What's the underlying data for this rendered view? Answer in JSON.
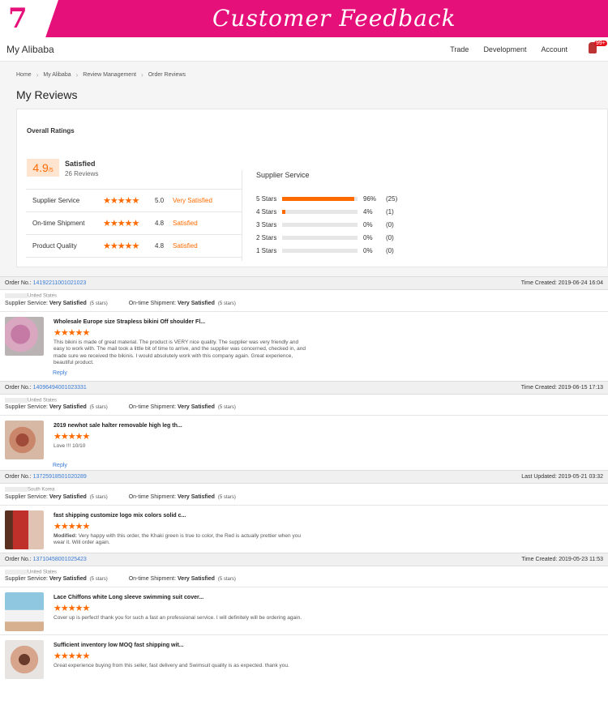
{
  "banner": {
    "number": "7",
    "title": "Customer Feedback"
  },
  "topbar": {
    "brand": "My Alibaba",
    "nav": [
      "Trade",
      "Development",
      "Account"
    ],
    "badge": "99+"
  },
  "breadcrumb": [
    "Home",
    "My Alibaba",
    "Review Management",
    "Order Reviews"
  ],
  "page_title": "My Reviews",
  "overall": {
    "heading": "Overall Ratings",
    "score": "4.9",
    "score_max": "/5",
    "label": "Satisfied",
    "reviews": "26 Reviews",
    "rows": [
      {
        "label": "Supplier Service",
        "value": "5.0",
        "desc": "Very Satisfied"
      },
      {
        "label": "On-time Shipment",
        "value": "4.8",
        "desc": "Satisfied"
      },
      {
        "label": "Product Quality",
        "value": "4.8",
        "desc": "Satisfied"
      }
    ],
    "supplier_service": {
      "title": "Supplier Service",
      "bars": [
        {
          "stars": "5 Stars",
          "pct": "96%",
          "count": "(25)",
          "fraction": 0.96
        },
        {
          "stars": "4 Stars",
          "pct": "4%",
          "count": "(1)",
          "fraction": 0.04
        },
        {
          "stars": "3 Stars",
          "pct": "0%",
          "count": "(0)",
          "fraction": 0
        },
        {
          "stars": "2 Stars",
          "pct": "0%",
          "count": "(0)",
          "fraction": 0
        },
        {
          "stars": "1 Stars",
          "pct": "0%",
          "count": "(0)",
          "fraction": 0
        }
      ]
    }
  },
  "stars_glyph": "★★★★★",
  "orders": [
    {
      "order_label": "Order No.:",
      "order_no": "14192211001021023",
      "time": "Time Created: 2019-06-24 16:04",
      "country": "United States",
      "supplier_service": "Very Satisfied",
      "supplier_stars": "(5 stars)",
      "shipment": "Very Satisfied",
      "shipment_stars": "(5 stars)",
      "items": [
        {
          "title": "Wholesale Europe size Strapless bikini Off shoulder Fl...",
          "comment": "This bikini is made of great material. The product is VERY nice quality. The supplier was very friendly and easy to work with. The mail took a little bit of time to arrive, and the supplier was concerned, checked in, and made sure we received the bikinis. I would absolutely work with this company again. Great experience, beautiful product.",
          "modified": ""
        }
      ],
      "reply": "Reply"
    },
    {
      "order_label": "Order No.:",
      "order_no": "14096494001023331",
      "time": "Time Created: 2019-06-15 17:13",
      "country": "United States",
      "supplier_service": "Very Satisfied",
      "supplier_stars": "(5 stars)",
      "shipment": "Very Satisfied",
      "shipment_stars": "(5 stars)",
      "items": [
        {
          "title": "2019 newhot sale halter removable high leg th...",
          "comment": "Love !!! 10/10",
          "modified": ""
        }
      ],
      "reply": "Reply"
    },
    {
      "order_label": "Order No.:",
      "order_no": "13725918501020289",
      "time": "Last Updated: 2019-05-21 03:32",
      "country": "South Korea",
      "supplier_service": "Very Satisfied",
      "supplier_stars": "(5 stars)",
      "shipment": "Very Satisfied",
      "shipment_stars": "(5 stars)",
      "items": [
        {
          "title": "fast shipping customize logo mix colors solid c...",
          "comment": "Very happy with this order, the Khaki green is true to color, the Red is actually prettier when you wear it. Will order again.",
          "modified": "Modified:"
        }
      ],
      "reply": ""
    },
    {
      "order_label": "Order No.:",
      "order_no": "13710458001025423",
      "time": "Time Created: 2019-05-23 11:53",
      "country": "United States",
      "supplier_service": "Very Satisfied",
      "supplier_stars": "(5 stars)",
      "shipment": "Very Satisfied",
      "shipment_stars": "(5 stars)",
      "items": [
        {
          "title": "Lace Chiffons white Long sleeve swimming suit cover...",
          "comment": "Cover up is perfect! thank you for such a fast an professional service. I will definitely will be ordering again.",
          "modified": ""
        },
        {
          "title": "Sufficient inventory low MOQ fast shipping wit...",
          "comment": "Great experience buying from this seller, fast delivery and Swimsuit quality is as expected. thank you.",
          "modified": ""
        }
      ],
      "reply": ""
    }
  ],
  "labels": {
    "supplier_service": "Supplier Service:",
    "shipment": "On-time Shipment:"
  }
}
